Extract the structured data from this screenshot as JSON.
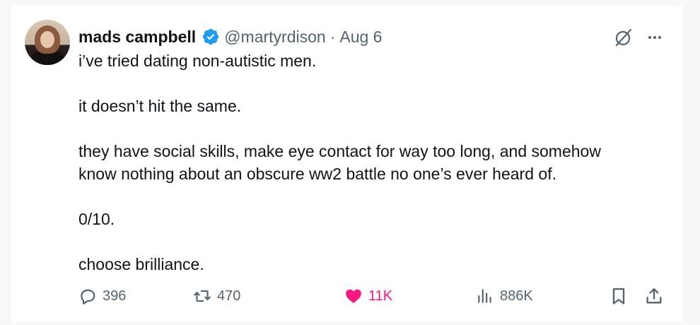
{
  "tweet": {
    "author": {
      "display_name": "mads campbell",
      "handle": "@martyrdison",
      "verified": true
    },
    "separator": "·",
    "date": "Aug 6",
    "paragraphs": [
      [
        "i’ve tried dating non-autistic men."
      ],
      [
        "it doesn’t hit the same."
      ],
      [
        "they have social skills, make eye contact for way too long, and somehow",
        "know nothing about an obscure ww2 battle no one’s ever heard of."
      ],
      [
        "0/10."
      ],
      [
        "choose brilliance."
      ]
    ],
    "metrics": {
      "replies": "396",
      "reposts": "470",
      "likes": "11K",
      "views": "886K"
    },
    "liked": true
  },
  "colors": {
    "accent_like": "#f91880",
    "verified_blue": "#1d9bf0",
    "muted_text": "#536471",
    "text": "#0f1419"
  },
  "icons": [
    "verified-badge-icon",
    "grok-icon",
    "more-icon",
    "reply-icon",
    "repost-icon",
    "like-icon",
    "views-icon",
    "bookmark-icon",
    "share-icon"
  ]
}
